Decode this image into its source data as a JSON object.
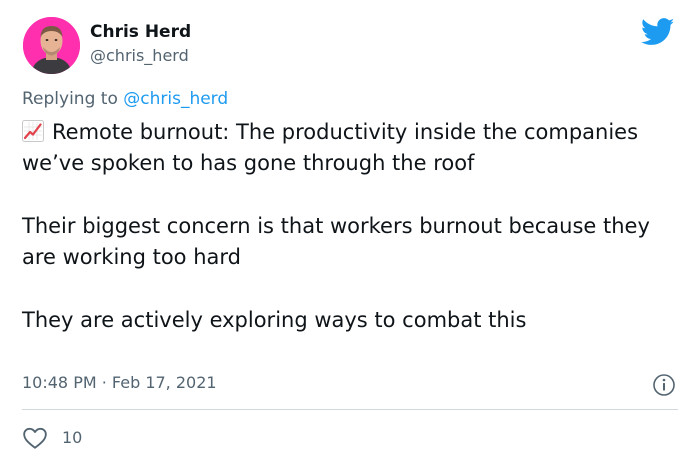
{
  "author": {
    "display_name": "Chris Herd",
    "handle": "@chris_herd",
    "avatar_bg": "#ff2fae"
  },
  "brand": {
    "logo_icon": "twitter-bird-icon",
    "color": "#1d9bf0"
  },
  "reply": {
    "prefix": "Replying to",
    "target": "@chris_herd"
  },
  "tweet": {
    "emoji": "chart-increasing-icon",
    "paragraph1": "Remote burnout: The productivity inside the companies we’ve spoken to has gone through the roof",
    "paragraph2": "Their biggest concern is that workers burnout because they are working too hard",
    "paragraph3": "They are actively exploring ways to combat this"
  },
  "meta": {
    "timestamp": "10:48 PM · Feb 17, 2021",
    "info_icon": "info-icon"
  },
  "actions": {
    "like_icon": "heart-icon",
    "like_count": "10"
  }
}
